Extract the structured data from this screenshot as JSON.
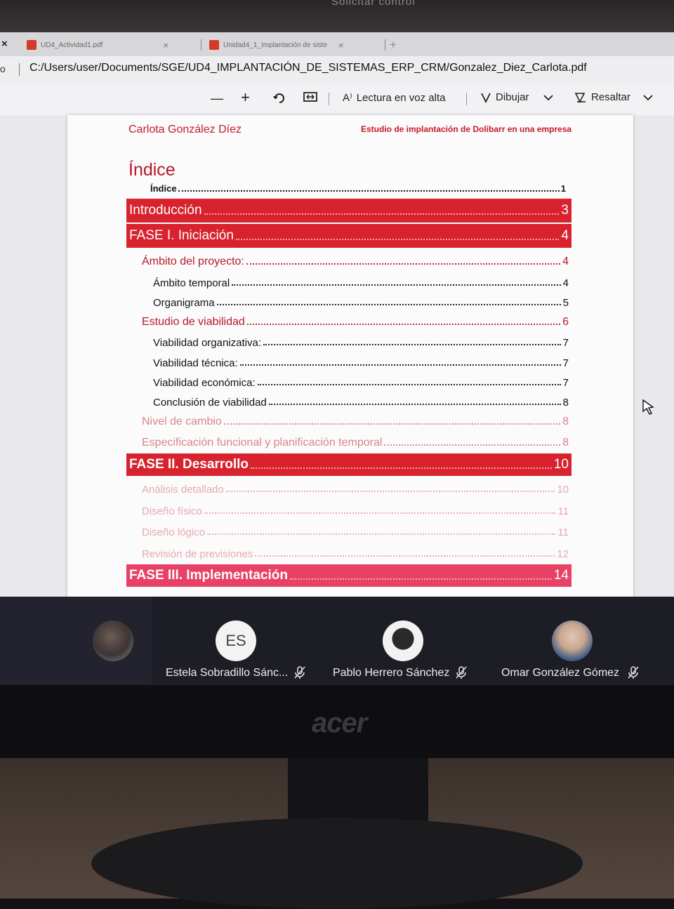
{
  "meeting_banner": "Solicitar control",
  "browser": {
    "close_label": "×",
    "tabs": [
      {
        "title": "UD4_Actividad1.pdf",
        "close": "×"
      },
      {
        "title": "Unidad4_1_Implantación de siste",
        "close": "×"
      }
    ],
    "new_tab": "+",
    "address_prefix": "o",
    "url": "C:/Users/user/Documents/SGE/UD4_IMPLANTACIÓN_DE_SISTEMAS_ERP_CRM/Gonzalez_Diez_Carlota.pdf"
  },
  "pdf_toolbar": {
    "zoom_out": "—",
    "zoom_in": "+",
    "read_aloud": "Lectura en voz alta",
    "draw": "Dibujar",
    "highlight": "Resaltar",
    "read_aloud_icon": "A⁾"
  },
  "document": {
    "author": "Carlota González Díez",
    "subtitle": "Estudio de implantación de Dolibarr en una empresa",
    "index_title": "Índice",
    "index_entry": {
      "label": "Índice",
      "page": "1"
    },
    "toc": [
      {
        "label": "Introducción",
        "page": "3"
      },
      {
        "label": "FASE I. Iniciación",
        "page": "4"
      },
      {
        "label": "Ámbito del proyecto:",
        "page": "4"
      },
      {
        "label": "Ámbito temporal",
        "page": "4"
      },
      {
        "label": "Organigrama",
        "page": "5"
      },
      {
        "label": "Estudio de viabilidad",
        "page": "6"
      },
      {
        "label": "Viabilidad organizativa:",
        "page": "7"
      },
      {
        "label": "Viabilidad técnica:",
        "page": "7"
      },
      {
        "label": "Viabilidad económica:",
        "page": "7"
      },
      {
        "label": "Conclusión de viabilidad",
        "page": "8"
      },
      {
        "label": "Nivel de cambio",
        "page": "8"
      },
      {
        "label": "Especificación funcional y planificación temporal",
        "page": "8"
      },
      {
        "label": "FASE II. Desarrollo",
        "page": "10"
      },
      {
        "label": "Análisis detallado",
        "page": "10"
      },
      {
        "label": "Diseño físico",
        "page": "11"
      },
      {
        "label": "Diseño lógico",
        "page": "11"
      },
      {
        "label": "Revisión de previsiones",
        "page": "12"
      },
      {
        "label": "FASE III. Implementación",
        "page": "14"
      }
    ]
  },
  "meeting": {
    "participants": [
      {
        "initials": "ES",
        "name": "Estela Sobradillo Sánc..."
      },
      {
        "name": "Pablo Herrero Sánchez"
      },
      {
        "name": "Omar González Gómez"
      }
    ]
  },
  "monitor_brand": "acer",
  "colors": {
    "accent_red": "#d8232f",
    "accent_pink": "#e74265",
    "doc_red_text": "#b8182a"
  }
}
